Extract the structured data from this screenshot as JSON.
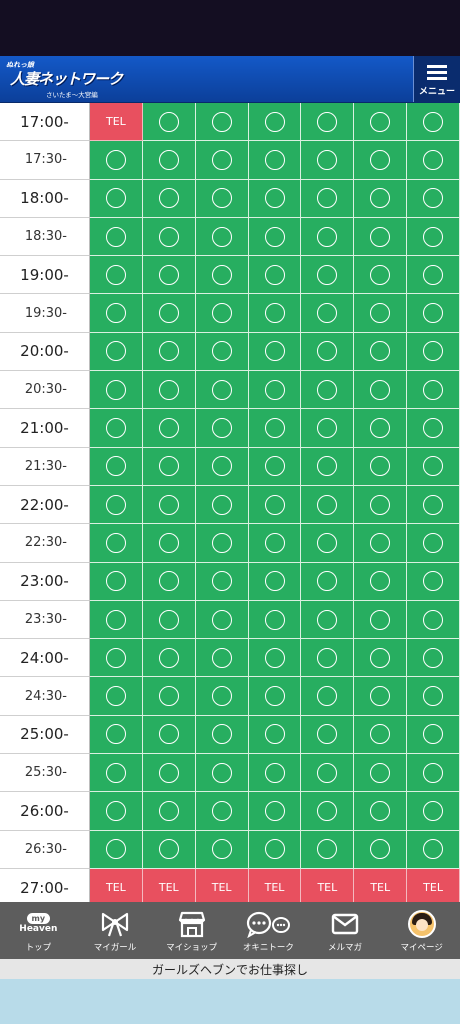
{
  "header": {
    "logo_tagline": "ぬれっ娘",
    "logo_name": "人妻ネットワーク",
    "logo_sub": "さいたま～大宮編",
    "menu_label": "メニュー"
  },
  "schedule": {
    "cell_ok_symbol": "〇",
    "tel_label": "TEL",
    "rows": [
      {
        "time": "17:00-",
        "cells": [
          "tel",
          "ok",
          "ok",
          "ok",
          "ok",
          "ok",
          "ok"
        ]
      },
      {
        "time": "17:30-",
        "cells": [
          "ok",
          "ok",
          "ok",
          "ok",
          "ok",
          "ok",
          "ok"
        ]
      },
      {
        "time": "18:00-",
        "cells": [
          "ok",
          "ok",
          "ok",
          "ok",
          "ok",
          "ok",
          "ok"
        ]
      },
      {
        "time": "18:30-",
        "cells": [
          "ok",
          "ok",
          "ok",
          "ok",
          "ok",
          "ok",
          "ok"
        ]
      },
      {
        "time": "19:00-",
        "cells": [
          "ok",
          "ok",
          "ok",
          "ok",
          "ok",
          "ok",
          "ok"
        ]
      },
      {
        "time": "19:30-",
        "cells": [
          "ok",
          "ok",
          "ok",
          "ok",
          "ok",
          "ok",
          "ok"
        ]
      },
      {
        "time": "20:00-",
        "cells": [
          "ok",
          "ok",
          "ok",
          "ok",
          "ok",
          "ok",
          "ok"
        ]
      },
      {
        "time": "20:30-",
        "cells": [
          "ok",
          "ok",
          "ok",
          "ok",
          "ok",
          "ok",
          "ok"
        ]
      },
      {
        "time": "21:00-",
        "cells": [
          "ok",
          "ok",
          "ok",
          "ok",
          "ok",
          "ok",
          "ok"
        ]
      },
      {
        "time": "21:30-",
        "cells": [
          "ok",
          "ok",
          "ok",
          "ok",
          "ok",
          "ok",
          "ok"
        ]
      },
      {
        "time": "22:00-",
        "cells": [
          "ok",
          "ok",
          "ok",
          "ok",
          "ok",
          "ok",
          "ok"
        ]
      },
      {
        "time": "22:30-",
        "cells": [
          "ok",
          "ok",
          "ok",
          "ok",
          "ok",
          "ok",
          "ok"
        ]
      },
      {
        "time": "23:00-",
        "cells": [
          "ok",
          "ok",
          "ok",
          "ok",
          "ok",
          "ok",
          "ok"
        ]
      },
      {
        "time": "23:30-",
        "cells": [
          "ok",
          "ok",
          "ok",
          "ok",
          "ok",
          "ok",
          "ok"
        ]
      },
      {
        "time": "24:00-",
        "cells": [
          "ok",
          "ok",
          "ok",
          "ok",
          "ok",
          "ok",
          "ok"
        ]
      },
      {
        "time": "24:30-",
        "cells": [
          "ok",
          "ok",
          "ok",
          "ok",
          "ok",
          "ok",
          "ok"
        ]
      },
      {
        "time": "25:00-",
        "cells": [
          "ok",
          "ok",
          "ok",
          "ok",
          "ok",
          "ok",
          "ok"
        ]
      },
      {
        "time": "25:30-",
        "cells": [
          "ok",
          "ok",
          "ok",
          "ok",
          "ok",
          "ok",
          "ok"
        ]
      },
      {
        "time": "26:00-",
        "cells": [
          "ok",
          "ok",
          "ok",
          "ok",
          "ok",
          "ok",
          "ok"
        ]
      },
      {
        "time": "26:30-",
        "cells": [
          "ok",
          "ok",
          "ok",
          "ok",
          "ok",
          "ok",
          "ok"
        ]
      },
      {
        "time": "27:00-",
        "cells": [
          "tel",
          "tel",
          "tel",
          "tel",
          "tel",
          "tel",
          "tel"
        ]
      }
    ]
  },
  "bottom_nav": {
    "items": [
      {
        "label": "トップ",
        "icon": "my-heaven-icon",
        "badge_top": "my",
        "badge_bottom": "Heaven"
      },
      {
        "label": "マイガール",
        "icon": "ribbon-icon"
      },
      {
        "label": "マイショップ",
        "icon": "shop-icon"
      },
      {
        "label": "オキニトーク",
        "icon": "chat-icon"
      },
      {
        "label": "メルマガ",
        "icon": "mail-icon"
      },
      {
        "label": "マイページ",
        "icon": "avatar-icon"
      }
    ]
  },
  "job_bar": {
    "label": "ガールズヘブンでお仕事探し"
  },
  "colors": {
    "available": "#27ae60",
    "tel": "#e8505f",
    "header": "#1459c8",
    "nav": "#5d5d5d"
  }
}
